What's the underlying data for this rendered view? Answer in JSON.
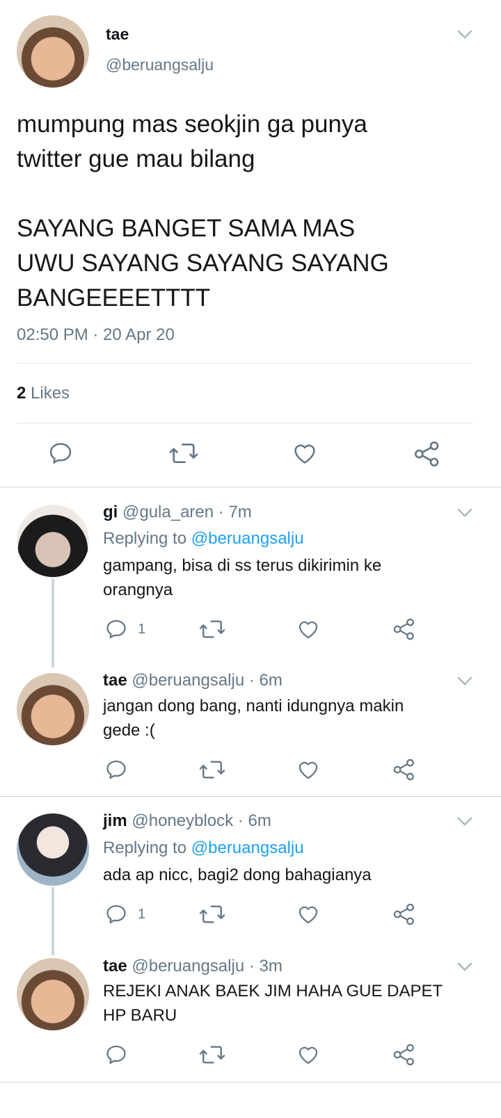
{
  "main_tweet": {
    "name": "tae",
    "handle": "@beruangsalju",
    "text": "mumpung mas seokjin ga punya\ntwitter gue mau bilang\n\nSAYANG BANGET SAMA MAS\nUWU SAYANG SAYANG SAYANG\nBANGEEEETTTT",
    "timestamp": "02:50 PM · 20 Apr 20",
    "likes_count": "2",
    "likes_label": "Likes"
  },
  "replies": [
    {
      "name": "gi",
      "meta": "@gula_aren · 7m",
      "replying_prefix": "Replying to",
      "replying_to": "@beruangsalju",
      "text": "gampang, bisa di ss terus dikirimin ke\norangnya",
      "reply_count": "1"
    },
    {
      "name": "tae",
      "meta": "@beruangsalju · 6m",
      "text": "jangan dong bang, nanti idungnya makin\ngede :("
    },
    {
      "name": "jim",
      "meta": "@honeyblock · 6m",
      "replying_prefix": "Replying to",
      "replying_to": "@beruangsalju",
      "text": "ada ap nicc, bagi2 dong bahagianya",
      "reply_count": "1"
    },
    {
      "name": "tae",
      "meta": "@beruangsalju · 3m",
      "text": "REJEKI ANAK BAEK JIM HAHA GUE DAPET\nHP BARU"
    }
  ],
  "icons": {
    "reply": "reply-icon",
    "retweet": "retweet-icon",
    "like": "heart-icon",
    "share": "share-icon",
    "menu": "chevron-down-icon"
  },
  "colors": {
    "text": "#14171a",
    "secondary": "#657786",
    "link": "#1da1f2",
    "divider": "#e1e8ed",
    "thread_line": "#ccd6dd"
  }
}
